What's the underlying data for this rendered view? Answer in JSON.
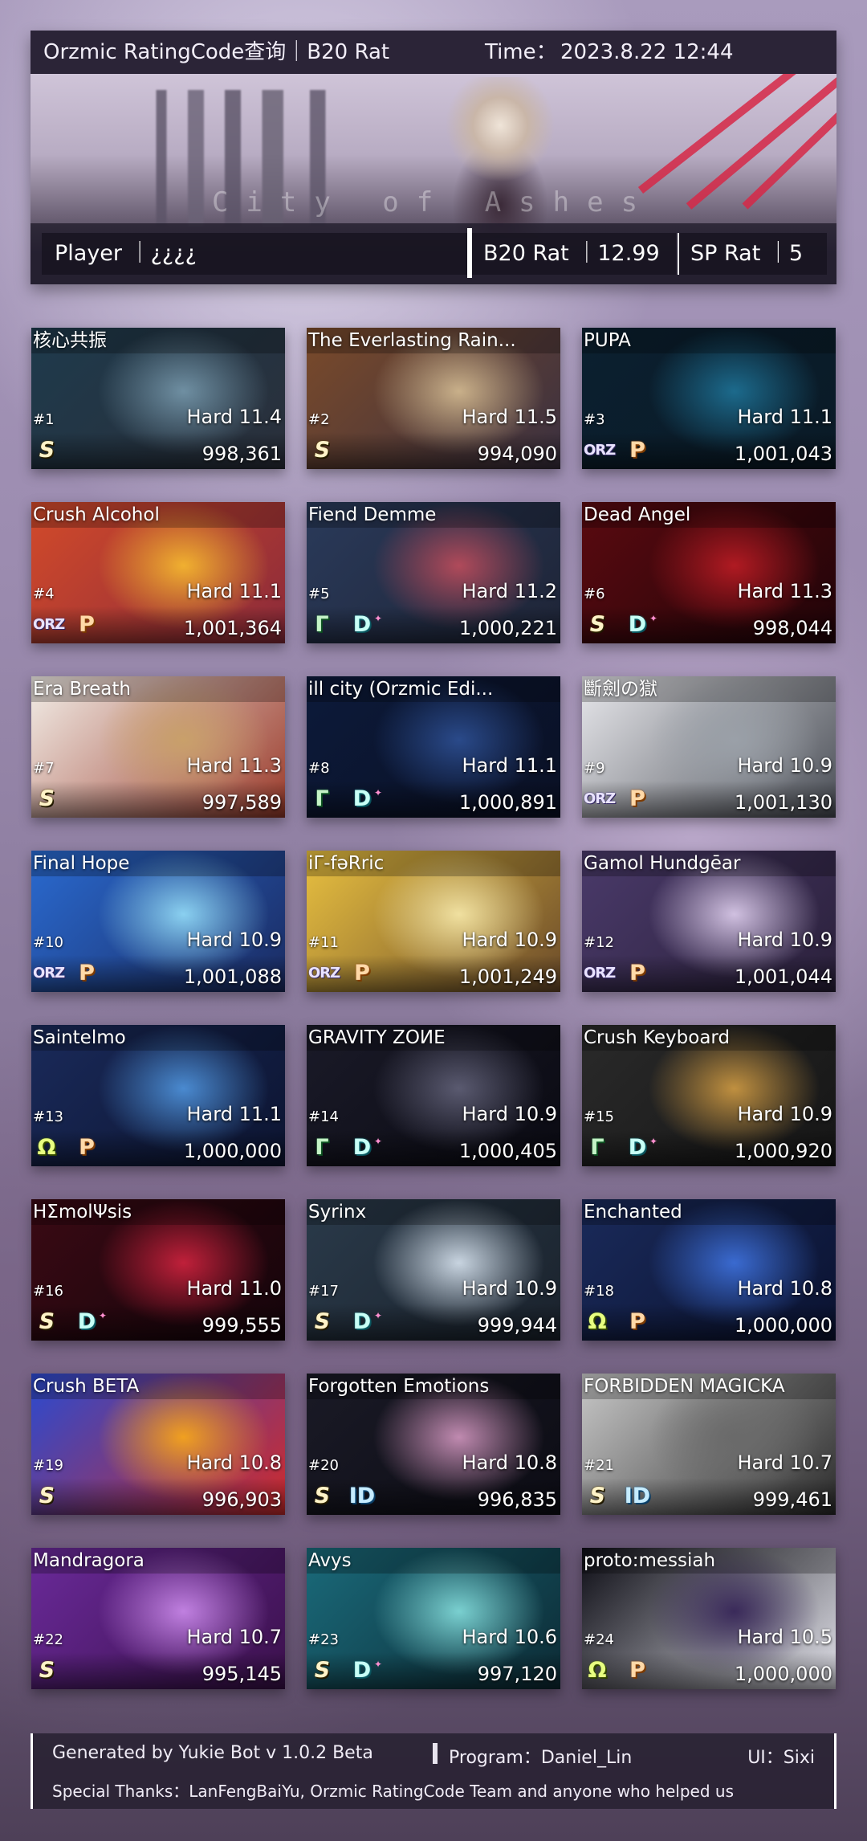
{
  "header": {
    "title": "Orzmic RatingCode查询｜B20 Rat",
    "time_label": "Time：",
    "time_value": "2023.8.22  12:44",
    "banner_text": "City of Ashes",
    "player_label": "Player ｜¿¿¿¿",
    "b20_label": "B20 Rat ｜12.99",
    "sp_label": "SP Rat ｜5"
  },
  "cards": [
    {
      "title": "核心共振",
      "rank": "#1",
      "difficulty": "Hard 11.4",
      "score": "998,361",
      "badges": [
        "S"
      ],
      "art": [
        "#1e3a4c",
        "#6f8fa2",
        "#2a2f3a"
      ]
    },
    {
      "title": "The Everlasting Rain...",
      "rank": "#2",
      "difficulty": "Hard 11.5",
      "score": "994,090",
      "badges": [
        "S"
      ],
      "art": [
        "#7a4a2a",
        "#c9b08a",
        "#3a3040"
      ]
    },
    {
      "title": "PUPA",
      "rank": "#3",
      "difficulty": "Hard 11.1",
      "score": "1,001,043",
      "badges": [
        "ORZ",
        "P"
      ],
      "art": [
        "#0b2030",
        "#1c6a8c",
        "#0a1a26"
      ]
    },
    {
      "title": "Crush Alcohol",
      "rank": "#4",
      "difficulty": "Hard 11.1",
      "score": "1,001,364",
      "badges": [
        "ORZ",
        "P"
      ],
      "art": [
        "#d24a2a",
        "#f0b030",
        "#8a2a3a"
      ]
    },
    {
      "title": "Fiend Demme",
      "rank": "#5",
      "difficulty": "Hard 11.2",
      "score": "1,000,221",
      "badges": [
        "R",
        "D+"
      ],
      "art": [
        "#2a3a5a",
        "#b04a5a",
        "#1e2436"
      ]
    },
    {
      "title": "Dead Angel",
      "rank": "#6",
      "difficulty": "Hard 11.3",
      "score": "998,044",
      "badges": [
        "S",
        "D+"
      ],
      "art": [
        "#5a0a10",
        "#b01a22",
        "#200408"
      ]
    },
    {
      "title": "Era Breath",
      "rank": "#7",
      "difficulty": "Hard 11.3",
      "score": "997,589",
      "badges": [
        "S"
      ],
      "art": [
        "#f2eee8",
        "#c9a06a",
        "#9a3a2a"
      ]
    },
    {
      "title": "ill city (Orzmic Edi...",
      "rank": "#8",
      "difficulty": "Hard 11.1",
      "score": "1,000,891",
      "badges": [
        "R",
        "D+"
      ],
      "art": [
        "#0c1a3a",
        "#2a4a8a",
        "#0a1024"
      ]
    },
    {
      "title": "斷劍の獄",
      "rank": "#9",
      "difficulty": "Hard 10.9",
      "score": "1,001,130",
      "badges": [
        "ORZ",
        "P"
      ],
      "art": [
        "#e8e8ec",
        "#9aa0a8",
        "#4a4e56"
      ]
    },
    {
      "title": "Final Hope",
      "rank": "#10",
      "difficulty": "Hard 10.9",
      "score": "1,001,088",
      "badges": [
        "ORZ",
        "P"
      ],
      "art": [
        "#2a6ad0",
        "#8ad0f0",
        "#1a2a60"
      ]
    },
    {
      "title": "iΓ-fəRric",
      "rank": "#11",
      "difficulty": "Hard 10.9",
      "score": "1,001,249",
      "badges": [
        "ORZ",
        "P"
      ],
      "art": [
        "#e8c040",
        "#f0e0a0",
        "#6a4a2a"
      ]
    },
    {
      "title": "Gamol Hundgēar",
      "rank": "#12",
      "difficulty": "Hard 10.9",
      "score": "1,001,044",
      "badges": [
        "ORZ",
        "P"
      ],
      "art": [
        "#4a3a6a",
        "#d0c0e0",
        "#2a203a"
      ]
    },
    {
      "title": "Saintelmo",
      "rank": "#13",
      "difficulty": "Hard 11.1",
      "score": "1,000,000",
      "badges": [
        "O",
        "P"
      ],
      "art": [
        "#1a2a5a",
        "#4a8ad0",
        "#0c1430"
      ]
    },
    {
      "title": "GRAVITY ZOИE",
      "rank": "#14",
      "difficulty": "Hard 10.9",
      "score": "1,000,405",
      "badges": [
        "R",
        "D+"
      ],
      "art": [
        "#1a1a28",
        "#5a5a70",
        "#0a0a12"
      ]
    },
    {
      "title": "Crush Keyboard",
      "rank": "#15",
      "difficulty": "Hard 10.9",
      "score": "1,000,920",
      "badges": [
        "R",
        "D+"
      ],
      "art": [
        "#2a2a2a",
        "#c09040",
        "#151515"
      ]
    },
    {
      "title": "HΣmolΨsis",
      "rank": "#16",
      "difficulty": "Hard 11.0",
      "score": "999,555",
      "badges": [
        "S",
        "D+"
      ],
      "art": [
        "#3a0a14",
        "#c0203a",
        "#14040a"
      ]
    },
    {
      "title": "Syrinx",
      "rank": "#17",
      "difficulty": "Hard 10.9",
      "score": "999,944",
      "badges": [
        "S",
        "D+"
      ],
      "art": [
        "#2a3a4a",
        "#c8d4e0",
        "#1a222c"
      ]
    },
    {
      "title": "Enchanted",
      "rank": "#18",
      "difficulty": "Hard 10.8",
      "score": "1,000,000",
      "badges": [
        "O",
        "P"
      ],
      "art": [
        "#1a2a5a",
        "#3a6ad0",
        "#0a1230"
      ]
    },
    {
      "title": "Crush BETA",
      "rank": "#19",
      "difficulty": "Hard 10.8",
      "score": "996,903",
      "badges": [
        "S"
      ],
      "art": [
        "#2a4ad0",
        "#f0a020",
        "#d02a2a"
      ]
    },
    {
      "title": "Forgotten Emotions",
      "rank": "#20",
      "difficulty": "Hard 10.8",
      "score": "996,835",
      "badges": [
        "S",
        "ID"
      ],
      "art": [
        "#1a1a26",
        "#c08ab0",
        "#0c0c14"
      ]
    },
    {
      "title": "FORBIDDEN MAGICKA",
      "rank": "#21",
      "difficulty": "Hard 10.7",
      "score": "999,461",
      "badges": [
        "S",
        "ID"
      ],
      "art": [
        "#c8c8c8",
        "#6a6a6a",
        "#2a2a2a"
      ]
    },
    {
      "title": "Mandragora",
      "rank": "#22",
      "difficulty": "Hard 10.7",
      "score": "995,145",
      "badges": [
        "S"
      ],
      "art": [
        "#6a2a9a",
        "#c080e0",
        "#3a104a"
      ]
    },
    {
      "title": "Avys",
      "rank": "#23",
      "difficulty": "Hard 10.6",
      "score": "997,120",
      "badges": [
        "S",
        "D+"
      ],
      "art": [
        "#1a6a7a",
        "#7ad0d0",
        "#0c2a34"
      ]
    },
    {
      "title": "proto:messiah",
      "rank": "#24",
      "difficulty": "Hard 10.5",
      "score": "1,000,000",
      "badges": [
        "O",
        "P"
      ],
      "art": [
        "#0c0c14",
        "#3a2a5a",
        "#e0e0e8"
      ]
    }
  ],
  "badge_text": {
    "S": "S",
    "ORZ": "ORZ",
    "P": "P",
    "R": "Γ",
    "D+": "D",
    "O": "Ω",
    "ID": "ID"
  },
  "footer": {
    "generated": "Generated by Yukie Bot v 1.0.2 Beta",
    "program": "Program：Daniel_Lin",
    "ui": "UI：Sixi",
    "thanks": "Special Thanks：LanFengBaiYu, Orzmic RatingCode Team and anyone who helped us"
  }
}
